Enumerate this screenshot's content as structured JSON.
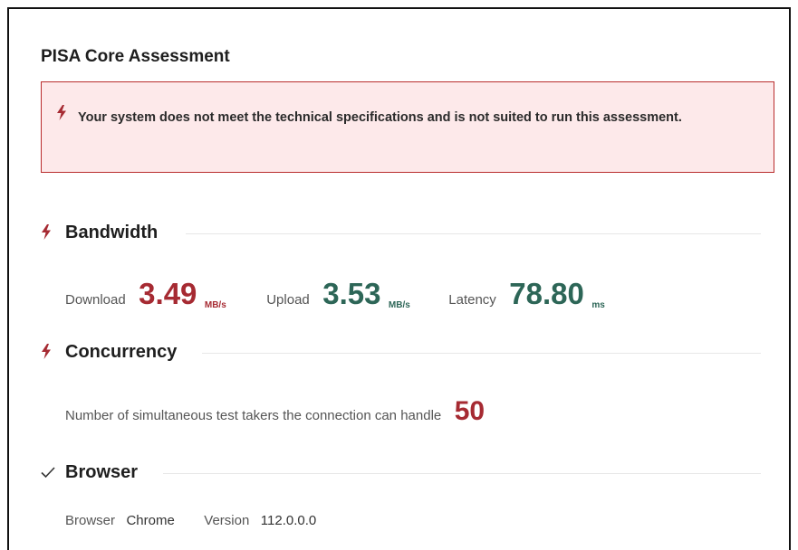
{
  "title": "PISA Core Assessment",
  "alert": {
    "icon": "bolt-icon",
    "message": "Your system does not meet the technical specifications and is not suited to run this assessment."
  },
  "bandwidth": {
    "status_icon": "bolt-icon",
    "title": "Bandwidth",
    "download": {
      "label": "Download",
      "value": "3.49",
      "unit": "MB/s",
      "status": "fail"
    },
    "upload": {
      "label": "Upload",
      "value": "3.53",
      "unit": "MB/s",
      "status": "pass"
    },
    "latency": {
      "label": "Latency",
      "value": "78.80",
      "unit": "ms",
      "status": "pass"
    }
  },
  "concurrency": {
    "status_icon": "bolt-icon",
    "title": "Concurrency",
    "label": "Number of simultaneous test takers the connection can handle",
    "value": "50",
    "status": "fail"
  },
  "browser": {
    "status_icon": "check-icon",
    "title": "Browser",
    "browser_label": "Browser",
    "browser_value": "Chrome",
    "version_label": "Version",
    "version_value": "112.0.0.0"
  },
  "colors": {
    "fail": "#a62a32",
    "pass": "#2d6657",
    "alert_bg": "#fde9ea",
    "alert_border": "#b92d2d"
  }
}
